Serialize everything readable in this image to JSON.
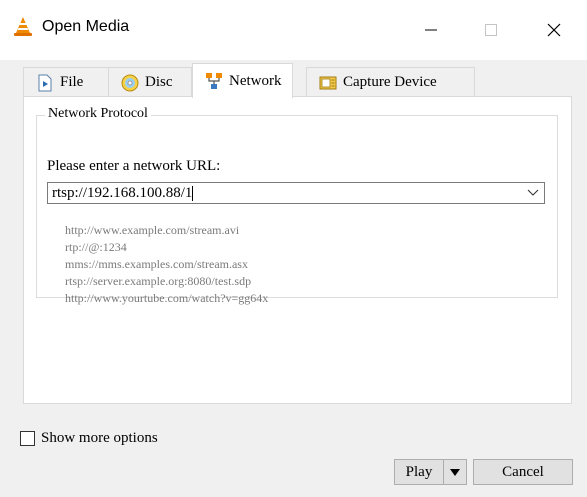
{
  "window": {
    "title": "Open Media",
    "app_icon": "vlc-cone-icon",
    "controls": [
      "minimize-icon",
      "maximize-icon",
      "close-icon"
    ]
  },
  "tabs": [
    {
      "label": "File",
      "icon": "file-play-icon"
    },
    {
      "label": "Disc",
      "icon": "disc-icon"
    },
    {
      "label": "Network",
      "icon": "network-icon",
      "active": true
    },
    {
      "label": "Capture Device",
      "icon": "capture-device-icon"
    }
  ],
  "network": {
    "group_title": "Network Protocol",
    "url_label": "Please enter a network URL:",
    "url_value": "rtsp://192.168.100.88/1",
    "examples": [
      "http://www.example.com/stream.avi",
      "rtp://@:1234",
      "mms://mms.examples.com/stream.asx",
      "rtsp://server.example.org:8080/test.sdp",
      "http://www.yourtube.com/watch?v=gg64x"
    ]
  },
  "options": {
    "show_more_label": "Show more options",
    "show_more_checked": false
  },
  "buttons": {
    "play": "Play",
    "cancel": "Cancel"
  },
  "colors": {
    "window_bg": "#f0f0f0",
    "panel_bg": "#ffffff",
    "example_text": "#7a7a7a",
    "vlc_orange": "#f08a00"
  }
}
